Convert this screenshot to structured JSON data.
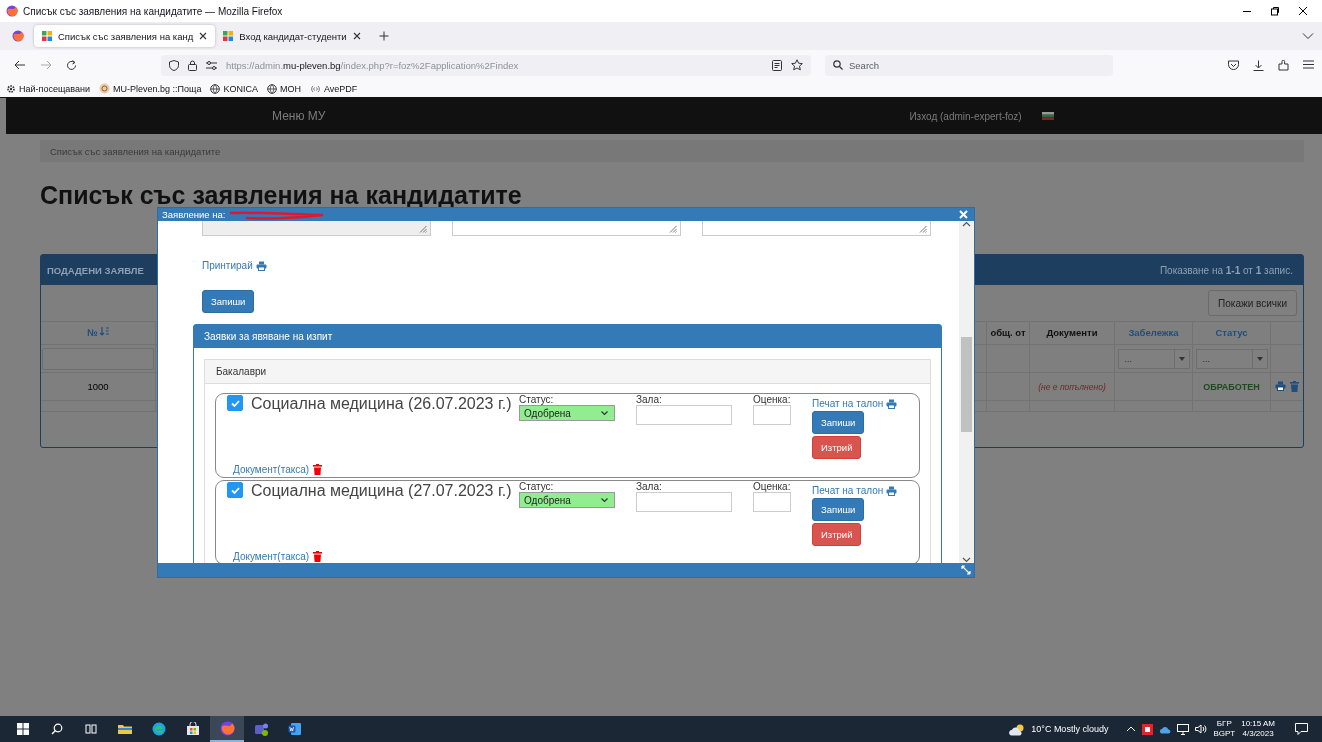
{
  "window": {
    "title": "Списък със заявления на кандидатите — Mozilla Firefox"
  },
  "tabs": [
    {
      "label": "Списък със заявления на канд",
      "selected": true
    },
    {
      "label": "Вход кандидат-студенти",
      "selected": false
    }
  ],
  "address_bar": {
    "url": "https://admin.**mu-pleven.bg**/index.php?r=foz%2Fapplication%2Findex"
  },
  "search": {
    "placeholder": "Search"
  },
  "bookmarks": [
    {
      "label": "Най-посещавани",
      "kind": "gear"
    },
    {
      "label": "MU-Pleven.bg ::Поща",
      "kind": "site"
    },
    {
      "label": "KONICA",
      "kind": "globe"
    },
    {
      "label": "MOH",
      "kind": "globe"
    },
    {
      "label": "AvePDF",
      "kind": "signal"
    }
  ],
  "navbar": {
    "menu": "Меню МУ",
    "logout": "Изход (admin-expert-foz)"
  },
  "breadcrumb": "Списък със заявления на кандидатите",
  "heading": "Списък със заявления на кандидатите",
  "applications_panel": {
    "title": "ПОДАДЕНИ ЗАЯВЛЕ",
    "summary": "Показване на **1-1** от **1** запис.",
    "show_all_button": "Покажи всички",
    "columns": [
      {
        "label": "№",
        "kind": "sortable",
        "filter": {
          "kind": "text"
        }
      },
      {
        "label": "общ. от",
        "kind": "plain"
      },
      {
        "label": "Документи",
        "kind": "plain"
      },
      {
        "label": "Забележка",
        "kind": "link",
        "filter": {
          "kind": "select",
          "placeholder": "..."
        }
      },
      {
        "label": "Статус",
        "kind": "link",
        "filter": {
          "kind": "select",
          "placeholder": "..."
        }
      }
    ],
    "rows": [
      {
        "number": "1000",
        "documents": "(не е попълнено)",
        "status": "ОБРАБОТЕН"
      }
    ]
  },
  "dialog": {
    "title": "Заявление на:",
    "print_link": "Принтирай",
    "save_button": "Запиши",
    "exams_panel": {
      "title": "Заявки за явяване на изпит",
      "group": "Бакалаври",
      "exams": [
        {
          "checked": true,
          "title": "Социална медицина (26.07.2023 г.)",
          "status_label": "Статус:",
          "status": "Одобрена",
          "hall_label": "Зала:",
          "grade_label": "Оценка:",
          "print_link": "Печат на талон",
          "save_button": "Запиши",
          "delete_button": "Изтрий",
          "document_link": "Документ(такса)"
        },
        {
          "checked": true,
          "title": "Социална медицина (27.07.2023 г.)",
          "status_label": "Статус:",
          "status": "Одобрена",
          "hall_label": "Зала:",
          "grade_label": "Оценка:",
          "print_link": "Печат на талон",
          "save_button": "Запиши",
          "delete_button": "Изтрий",
          "document_link": "Документ(такса)"
        }
      ]
    }
  },
  "taskbar": {
    "apps": [
      {
        "kind": "start",
        "active": false
      },
      {
        "kind": "search",
        "active": false
      },
      {
        "kind": "task-view",
        "active": false
      },
      {
        "kind": "explorer",
        "active": false
      },
      {
        "kind": "edge",
        "active": false
      },
      {
        "kind": "store",
        "active": false
      },
      {
        "kind": "firefox",
        "active": true
      },
      {
        "kind": "teams",
        "active": false
      },
      {
        "kind": "word",
        "active": false
      }
    ],
    "weather": "10°C Mostly cloudy",
    "language": "БГР",
    "layout": "BGPT",
    "time": "10:15 AM",
    "date": "4/3/2023"
  }
}
